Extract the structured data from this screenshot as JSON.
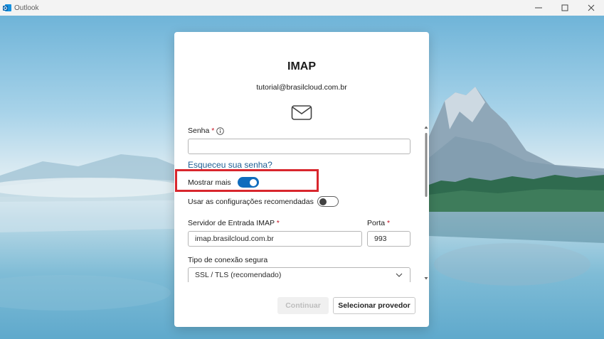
{
  "window": {
    "title": "Outlook"
  },
  "dialog": {
    "title": "IMAP",
    "email": "tutorial@brasilcloud.com.br",
    "password": {
      "label": "Senha",
      "required_mark": "*",
      "value": ""
    },
    "forgot_password_link": "Esqueceu sua senha?",
    "show_more": {
      "label": "Mostrar mais",
      "state": "on"
    },
    "recommended_settings": {
      "label": "Usar as configurações recomendadas",
      "state": "off"
    },
    "incoming_server": {
      "label": "Servidor de Entrada IMAP",
      "required_mark": "*",
      "value": "imap.brasilcloud.com.br"
    },
    "port": {
      "label": "Porta",
      "required_mark": "*",
      "value": "993"
    },
    "secure_connection": {
      "label": "Tipo de conexão segura",
      "selected": "SSL / TLS (recomendado)"
    },
    "buttons": {
      "continue": "Continuar",
      "select_provider": "Selecionar provedor"
    }
  },
  "colors": {
    "accent": "#0f6cbd",
    "highlight_box": "#d8262d",
    "required": "#c50f1f",
    "link": "#1f5f94"
  },
  "icons": [
    "outlook-app-icon",
    "minimize-icon",
    "maximize-icon",
    "close-icon",
    "mail-envelope-icon",
    "info-icon",
    "chevron-down-icon"
  ]
}
